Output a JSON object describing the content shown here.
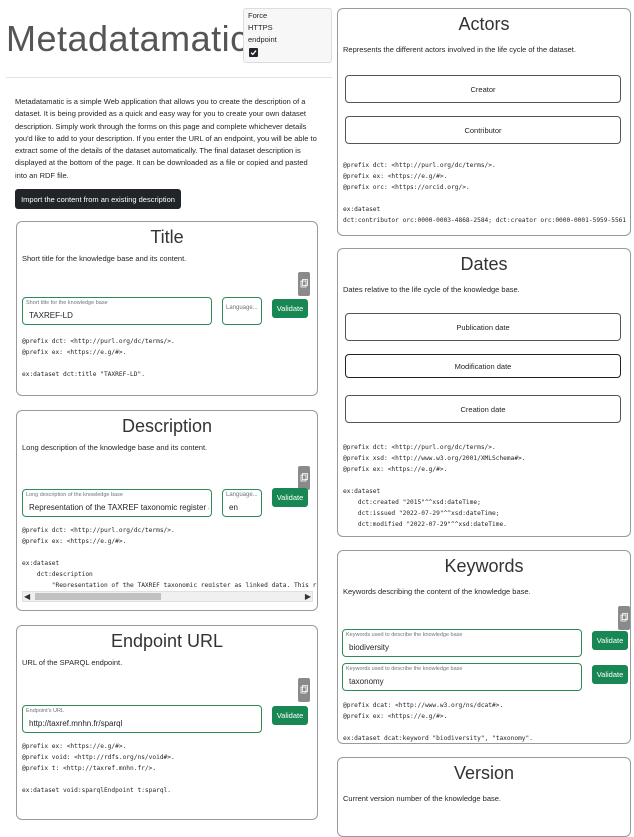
{
  "app": {
    "title": "Metadatamatic",
    "force_https_label_1": "Force",
    "force_https_label_2": "HTTPS",
    "force_https_label_3": "endpoint",
    "force_https_checked": true,
    "intro": "Metadatamatic is a simple Web application that allows you to create the description of a dataset. It is being provided as a quick and easy way for you to create your own dataset description. Simply work through the forms on this page and complete whichever details you'd like to add to your description. If you enter the URL of an endpoint, you will be able to extract some of the details of the dataset automatically. The final dataset description is displayed at the bottom of the page. It can be downloaded as a file or copied and pasted into an RDF file.",
    "import_button": "Import the content from an existing description"
  },
  "title_card": {
    "title": "Title",
    "desc": "Short title for the knowledge base and its content.",
    "field_label": "Short title for the knowledge base",
    "field_value": "TAXREF-LD",
    "lang_placeholder": "Language...",
    "validate": "Validate",
    "code": "@prefix dct: <http://purl.org/dc/terms/>.\n@prefix ex: <https://e.g/#>.\n\nex:dataset dct:title \"TAXREF-LD\"."
  },
  "description_card": {
    "title": "Description",
    "desc": "Long description of the knowledge base and its content.",
    "field_label": "Long description of the knowledge base",
    "field_value": "Representation of the TAXREF taxonomic register as link",
    "lang_label": "Language...",
    "lang_value": "en",
    "validate": "Validate",
    "code": "@prefix dct: <http://purl.org/dc/terms/>.\n@prefix ex: <https://e.g/#>.\n\nex:dataset\n    dct:description\n        \"Representation of the TAXREF taxonomic register as linked data. This r"
  },
  "endpoint_card": {
    "title": "Endpoint URL",
    "desc": "URL of the SPARQL endpoint.",
    "field_label": "Endpoint's URL",
    "field_value": "http://taxref.mnhn.fr/sparql",
    "validate": "Validate",
    "code": "@prefix ex: <https://e.g/#>.\n@prefix void: <http://rdfs.org/ns/void#>.\n@prefix t: <http://taxref.mnhn.fr/>.\n\nex:dataset void:sparqlEndpoint t:sparql."
  },
  "actors_card": {
    "title": "Actors",
    "desc": "Represents the different actors involved in the life cycle of the dataset.",
    "creator": "Creator",
    "contributor": "Contributor",
    "code": "@prefix dct: <http://purl.org/dc/terms/>.\n@prefix ex: <https://e.g/#>.\n@prefix orc: <https://orcid.org/>.\n\nex:dataset\ndct:contributor orc:0000-0003-4868-2584; dct:creator orc:0000-0001-5959-5561 ."
  },
  "dates_card": {
    "title": "Dates",
    "desc": "Dates relative to the life cycle of the knowledge base.",
    "publication": "Publication date",
    "modification": "Modification date",
    "creation": "Creation date",
    "code": "@prefix dct: <http://purl.org/dc/terms/>.\n@prefix xsd: <http://www.w3.org/2001/XMLSchema#>.\n@prefix ex: <https://e.g/#>.\n\nex:dataset\n    dct:created \"2015\"^^xsd:dateTime;\n    dct:issued \"2022-07-29\"^^xsd:dateTime;\n    dct:modified \"2022-07-29\"^^xsd:dateTime."
  },
  "keywords_card": {
    "title": "Keywords",
    "desc": "Keywords describing the content of the knowledge base.",
    "field_label": "Keywords used to describe the knowledge base",
    "kw1": "biodiversity",
    "kw2": "taxonomy",
    "validate": "Validate",
    "code": "@prefix dcat: <http://www.w3.org/ns/dcat#>.\n@prefix ex: <https://e.g/#>.\n\nex:dataset dcat:keyword \"biodiversity\", \"taxonomy\"."
  },
  "version_card": {
    "title": "Version",
    "desc": "Current version number of the knowledge base."
  },
  "colors": {
    "accent_green": "#198754",
    "field_border": "#2e8b57",
    "import_button_bg": "#212529"
  }
}
